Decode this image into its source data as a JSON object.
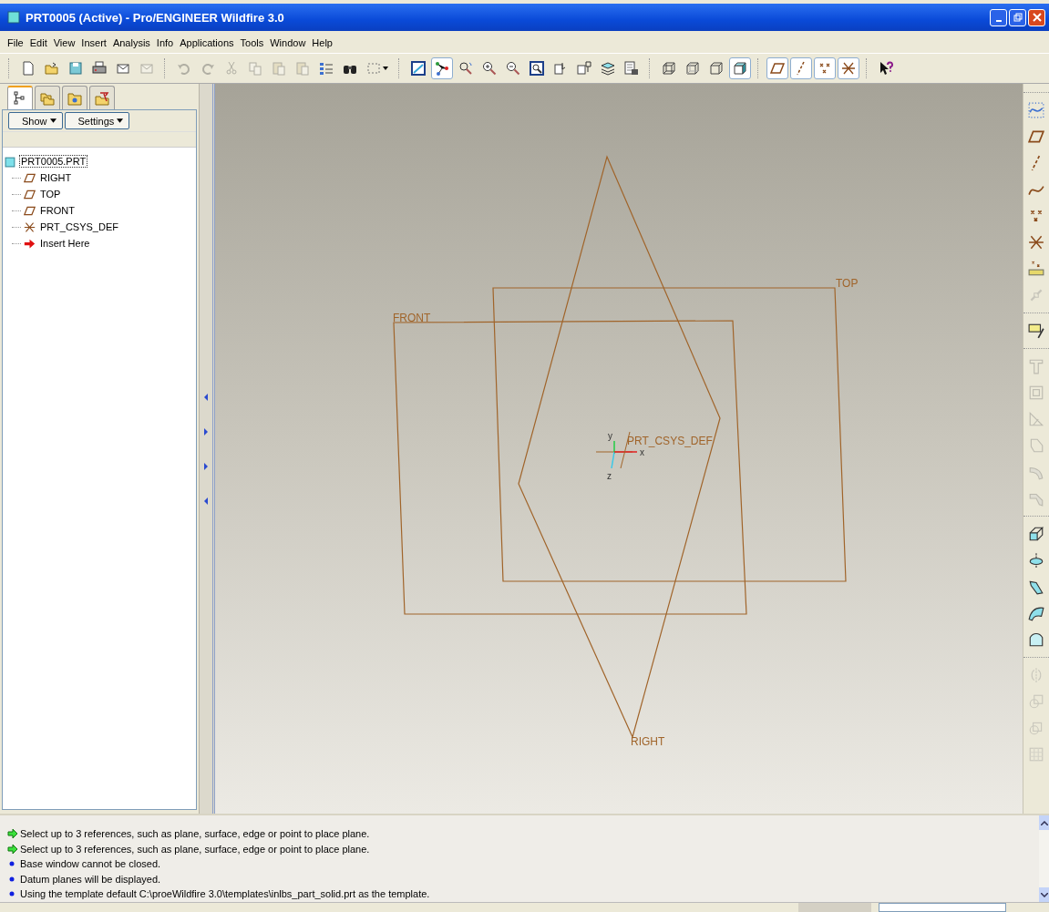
{
  "window": {
    "title": "PRT0005 (Active) - Pro/ENGINEER Wildfire 3.0"
  },
  "menu": [
    "File",
    "Edit",
    "View",
    "Insert",
    "Analysis",
    "Info",
    "Applications",
    "Tools",
    "Window",
    "Help"
  ],
  "toolbar": [
    [
      {
        "kind": "new",
        "disabled": false,
        "selected": false
      },
      {
        "kind": "open",
        "disabled": false,
        "selected": false
      },
      {
        "kind": "save",
        "disabled": false,
        "selected": false
      },
      {
        "kind": "print",
        "disabled": false,
        "selected": false
      },
      {
        "kind": "mail",
        "disabled": false,
        "selected": false
      },
      {
        "kind": "mail",
        "disabled": true,
        "selected": false
      }
    ],
    [
      {
        "kind": "undo",
        "disabled": true,
        "selected": false
      },
      {
        "kind": "redo",
        "disabled": true,
        "selected": false
      },
      {
        "kind": "cut",
        "disabled": true,
        "selected": false
      },
      {
        "kind": "copy",
        "disabled": true,
        "selected": false
      },
      {
        "kind": "paste",
        "disabled": true,
        "selected": false
      },
      {
        "kind": "paste",
        "disabled": true,
        "selected": false
      },
      {
        "kind": "regenerate",
        "disabled": false,
        "selected": false
      },
      {
        "kind": "find",
        "disabled": false,
        "selected": false
      },
      {
        "kind": "selectbox",
        "disabled": false,
        "selected": false
      }
    ],
    [
      {
        "kind": "repaint",
        "disabled": false,
        "selected": false
      },
      {
        "kind": "spin",
        "disabled": false,
        "selected": true
      },
      {
        "kind": "orient",
        "disabled": false,
        "selected": false
      },
      {
        "kind": "zoomin",
        "disabled": false,
        "selected": false
      },
      {
        "kind": "zoomout",
        "disabled": false,
        "selected": false
      },
      {
        "kind": "refit",
        "disabled": false,
        "selected": false
      },
      {
        "kind": "reorient",
        "disabled": false,
        "selected": false
      },
      {
        "kind": "annotate",
        "disabled": false,
        "selected": false
      },
      {
        "kind": "layers",
        "disabled": false,
        "selected": false
      },
      {
        "kind": "views",
        "disabled": false,
        "selected": false
      }
    ],
    [
      {
        "kind": "wire",
        "disabled": false,
        "selected": false
      },
      {
        "kind": "hidden",
        "disabled": false,
        "selected": false
      },
      {
        "kind": "nohidden",
        "disabled": false,
        "selected": false
      },
      {
        "kind": "shaded",
        "disabled": false,
        "selected": true
      }
    ],
    [
      {
        "kind": "plane",
        "disabled": false,
        "selected": true
      },
      {
        "kind": "axis",
        "disabled": false,
        "selected": true
      },
      {
        "kind": "point",
        "disabled": false,
        "selected": true
      },
      {
        "kind": "csys",
        "disabled": false,
        "selected": true
      }
    ],
    [
      {
        "kind": "help",
        "disabled": false,
        "selected": false
      }
    ]
  ],
  "side_tabs": [
    {
      "kind": "tree",
      "selected": true
    },
    {
      "kind": "folders",
      "selected": false
    },
    {
      "kind": "favorites",
      "selected": false
    },
    {
      "kind": "tools",
      "selected": false
    }
  ],
  "tree_buttons": [
    "Show",
    "Settings"
  ],
  "tree": {
    "label": "PRT0005.PRT",
    "selected": true,
    "children": [
      {
        "label": "RIGHT",
        "kind": "plane"
      },
      {
        "label": "TOP",
        "kind": "plane"
      },
      {
        "label": "FRONT",
        "kind": "plane"
      },
      {
        "label": "PRT_CSYS_DEF",
        "kind": "csys"
      },
      {
        "label": "Insert Here",
        "kind": "insert"
      }
    ]
  },
  "viewport": {
    "planes": [
      {
        "label": "RIGHT",
        "kind": "right"
      },
      {
        "label": "TOP",
        "kind": "top"
      },
      {
        "label": "FRONT",
        "kind": "front"
      }
    ],
    "csys": {
      "label": "PRT_CSYS_DEF",
      "x": "x",
      "y": "y",
      "z": "z"
    }
  },
  "right_toolbar": [
    [
      {
        "kind": "sketchcurve",
        "disabled": false
      },
      {
        "kind": "plane",
        "disabled": false
      },
      {
        "kind": "axis",
        "disabled": false
      },
      {
        "kind": "curve",
        "disabled": false
      },
      {
        "kind": "point",
        "disabled": false
      },
      {
        "kind": "csys",
        "disabled": false
      },
      {
        "kind": "analysis",
        "disabled": false
      },
      {
        "kind": "chain",
        "disabled": true
      }
    ],
    [
      {
        "kind": "sketch",
        "disabled": false
      }
    ],
    [
      {
        "kind": "hole",
        "disabled": true
      },
      {
        "kind": "shell",
        "disabled": true
      },
      {
        "kind": "rib",
        "disabled": true
      },
      {
        "kind": "draft",
        "disabled": true
      },
      {
        "kind": "round",
        "disabled": true
      },
      {
        "kind": "chamfer",
        "disabled": true
      }
    ],
    [
      {
        "kind": "extrude",
        "disabled": false
      },
      {
        "kind": "revolve",
        "disabled": false
      },
      {
        "kind": "sweep",
        "disabled": false
      },
      {
        "kind": "blend",
        "disabled": false
      },
      {
        "kind": "surface",
        "disabled": false
      }
    ],
    [
      {
        "kind": "mirror",
        "disabled": true
      },
      {
        "kind": "merge",
        "disabled": true
      },
      {
        "kind": "trim",
        "disabled": true
      },
      {
        "kind": "pattern",
        "disabled": true
      }
    ]
  ],
  "messages": [
    {
      "kind": "prompt",
      "text": "Select up to 3 references, such as plane, surface, edge or point to place plane."
    },
    {
      "kind": "prompt",
      "text": "Select up to 3 references, such as plane, surface, edge or point to place plane."
    },
    {
      "kind": "info",
      "text": "Base window cannot be closed."
    },
    {
      "kind": "info",
      "text": "Datum planes will be displayed."
    },
    {
      "kind": "info",
      "text": "Using the template default C:\\proeWildfire 3.0\\templates\\inlbs_part_solid.prt as the template."
    }
  ]
}
